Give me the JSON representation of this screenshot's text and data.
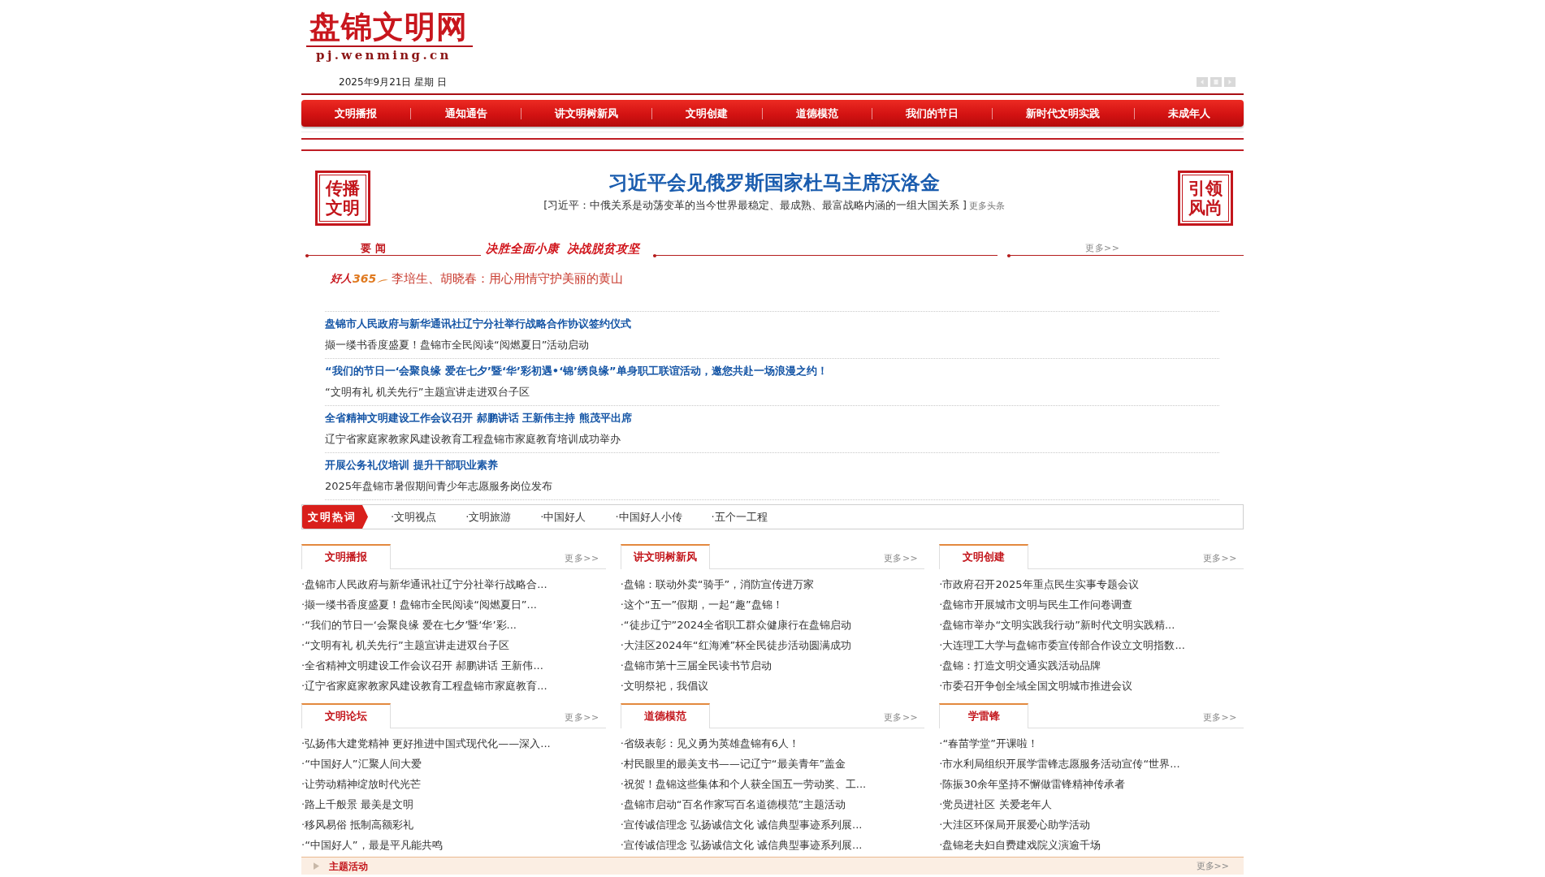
{
  "header": {
    "logo_title": "盘锦文明网",
    "logo_domain": "pj.wenming.cn",
    "date": "2025年9月21日 星期 日"
  },
  "nav": [
    {
      "label": "文明播报"
    },
    {
      "label": "通知通告"
    },
    {
      "label": "讲文明树新风"
    },
    {
      "label": "文明创建"
    },
    {
      "label": "道德模范"
    },
    {
      "label": "我们的节日"
    },
    {
      "label": "新时代文明实践"
    },
    {
      "label": "未成年人"
    }
  ],
  "banner": {
    "left_stamp": "传播文明",
    "title": "习近平会见俄罗斯国家杜马主席沃洛金",
    "summary": "[习近平：中俄关系是动荡变革的当今世界最稳定、最成熟、最富战略内涵的一组大国关系 ]",
    "more": "更多头条",
    "right_stamp": "引领风尚"
  },
  "news": {
    "heading": "要 闻",
    "slogan": "决胜全面小康  决战脱贫攻坚",
    "more": "更多>>",
    "featured": {
      "logo_word": "好人",
      "logo_number": "365",
      "title": "李培生、胡晓春：用心用情守护美丽的黄山"
    },
    "items": [
      {
        "title": "盘锦市人民政府与新华通讯社辽宁分社举行战略合作协议签约仪式",
        "subtitle": "撷一缕书香度盛夏！盘锦市全民阅读“阅燃夏日”活动启动"
      },
      {
        "title": "“我们的节日一‘会聚良缘 爱在七夕’暨‘华’彩初遇•‘锦’绣良缘”单身职工联谊活动，邀您共赴一场浪漫之约！",
        "subtitle": "“文明有礼 机关先行”主题宣讲走进双台子区"
      },
      {
        "title": "全省精神文明建设工作会议召开 郝鹏讲话 王新伟主持 熊茂平出席",
        "subtitle": "辽宁省家庭家教家风建设教育工程盘锦市家庭教育培训成功举办"
      },
      {
        "title": "开展公务礼仪培训 提升干部职业素养",
        "subtitle": "2025年盘锦市暑假期间青少年志愿服务岗位发布"
      }
    ]
  },
  "hot_words": {
    "label": "文明热词",
    "items": [
      "·文明视点",
      "·文明旅游",
      "·中国好人",
      "·中国好人小传",
      "·五个一工程"
    ]
  },
  "sections": [
    {
      "title": "文明播报",
      "more": "更多>>",
      "items": [
        "·盘锦市人民政府与新华通讯社辽宁分社举行战略合...",
        "·撷一缕书香度盛夏！盘锦市全民阅读“阅燃夏日”...",
        "·“我们的节日一‘会聚良缘 爱在七夕’暨‘华’彩...",
        "·“文明有礼 机关先行”主题宣讲走进双台子区",
        "·全省精神文明建设工作会议召开 郝鹏讲话 王新伟...",
        "·辽宁省家庭家教家风建设教育工程盘锦市家庭教育..."
      ]
    },
    {
      "title": "讲文明树新风",
      "more": "更多>>",
      "items": [
        "·盘锦：联动外卖“骑手”，消防宣传进万家",
        "·这个“五一”假期，一起“趣”盘锦！",
        "·“徒步辽宁”2024全省职工群众健康行在盘锦启动",
        "·大洼区2024年“红海滩”杯全民徒步活动圆满成功",
        "·盘锦市第十三届全民读书节启动",
        "·文明祭祀，我倡议"
      ]
    },
    {
      "title": "文明创建",
      "more": "更多>>",
      "items": [
        "·市政府召开2025年重点民生实事专题会议",
        "·盘锦市开展城市文明与民生工作问卷调查",
        "·盘锦市举办“文明实践我行动”新时代文明实践精...",
        "·大连理工大学与盘锦市委宣传部合作设立文明指数...",
        "·盘锦：打造文明交通实践活动品牌",
        "·市委召开争创全域全国文明城市推进会议"
      ]
    },
    {
      "title": "文明论坛",
      "more": "更多>>",
      "items": [
        "·弘扬伟大建党精神 更好推进中国式现代化——深入...",
        "·“中国好人”汇聚人间大爱",
        "·让劳动精神绽放时代光芒",
        "·路上千般景 最美是文明",
        "·移风易俗 抵制高额彩礼",
        "·“中国好人”，最是平凡能共鸣"
      ]
    },
    {
      "title": "道德模范",
      "more": "更多>>",
      "items": [
        "·省级表彰：见义勇为英雄盘锦有6人！",
        "·村民眼里的最美支书——记辽宁“最美青年”盖金",
        "·祝贺！盘锦这些集体和个人获全国五一劳动奖、工...",
        "·盘锦市启动“百名作家写百名道德模范”主题活动",
        "·宣传诚信理念 弘扬诚信文化 诚信典型事迹系列展...",
        "·宣传诚信理念 弘扬诚信文化 诚信典型事迹系列展..."
      ]
    },
    {
      "title": "学雷锋",
      "more": "更多>>",
      "items": [
        "·“春苗学堂”开课啦！",
        "·市水利局组织开展学雷锋志愿服务活动宣传“世界...",
        "·陈振30余年坚持不懈做雷锋精神传承者",
        "·党员进社区 关爱老年人",
        "·大洼区环保局开展爱心助学活动",
        "·盘锦老夫妇自费建戏院义演逾千场"
      ]
    }
  ],
  "bottom_bar": {
    "title": "主题活动",
    "more": "更多>>"
  }
}
